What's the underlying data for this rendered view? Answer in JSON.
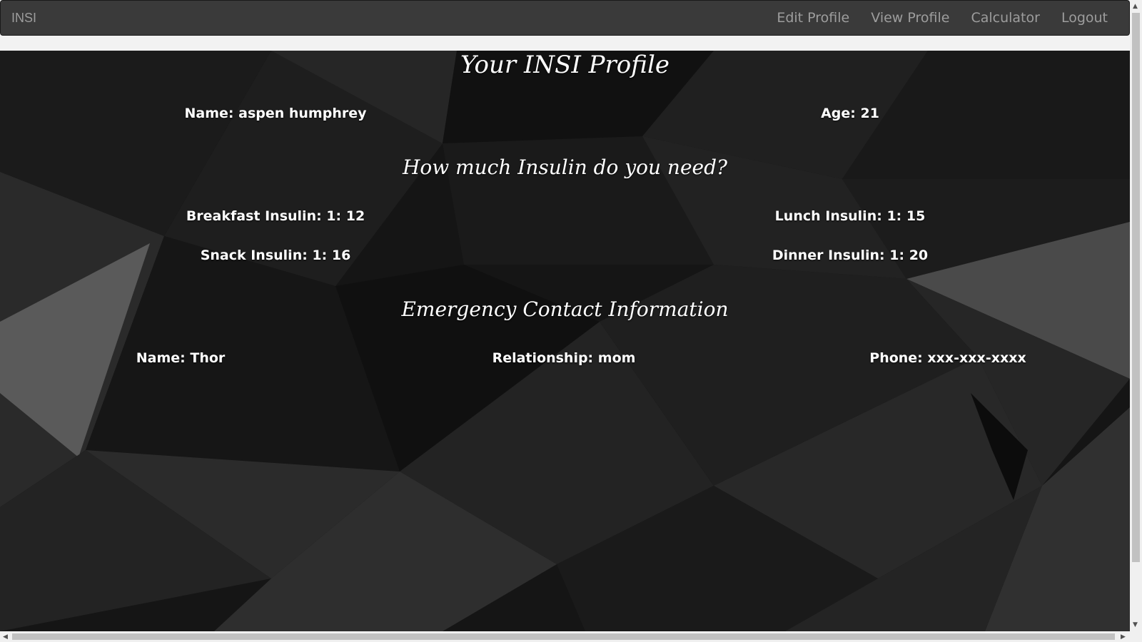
{
  "navbar": {
    "brand": "INSI",
    "links": [
      "Edit Profile",
      "View Profile",
      "Calculator",
      "Logout"
    ]
  },
  "profile": {
    "title": "Your INSI Profile",
    "name_label": "Name:",
    "name_value": "aspen humphrey",
    "age_label": "Age:",
    "age_value": "21"
  },
  "insulin": {
    "heading": "How much Insulin do you need?",
    "breakfast": "Breakfast Insulin: 1: 12",
    "lunch": "Lunch Insulin: 1: 15",
    "snack": "Snack Insulin: 1: 16",
    "dinner": "Dinner Insulin: 1: 20"
  },
  "emergency": {
    "heading": "Emergency Contact Information",
    "name": "Name: Thor",
    "relationship": "Relationship: mom",
    "phone": "Phone: xxx-xxx-xxxx"
  },
  "scrollbar": {
    "up_arrow": "▲",
    "down_arrow": "▼",
    "left_arrow": "◀",
    "right_arrow": "▶"
  }
}
